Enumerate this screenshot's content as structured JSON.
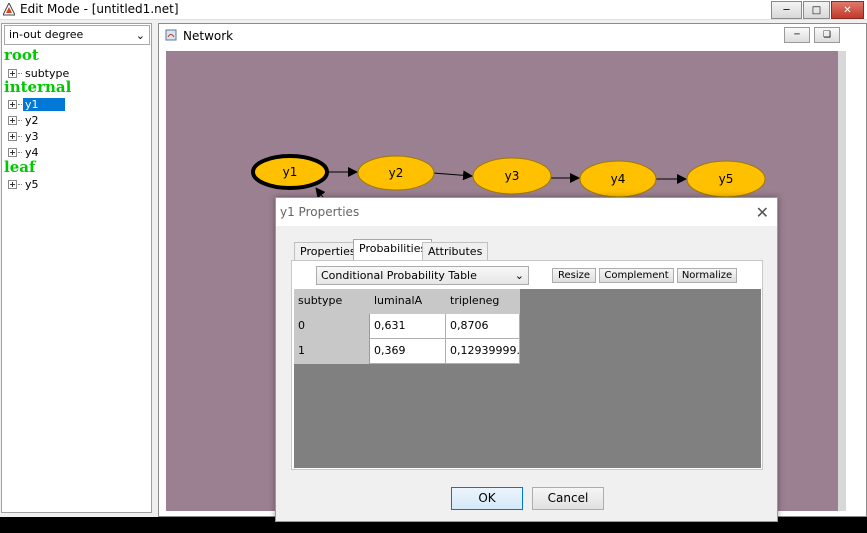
{
  "window": {
    "title": "Edit Mode - [untitled1.net]",
    "controls": [
      "minimize",
      "maximize",
      "close"
    ]
  },
  "left_panel": {
    "view_select": "in-out degree",
    "groups": [
      {
        "header": "root",
        "items": [
          "subtype"
        ]
      },
      {
        "header": "internal",
        "items": [
          "y1",
          "y2",
          "y3",
          "y4"
        ]
      },
      {
        "header": "leaf",
        "items": [
          "y5"
        ]
      }
    ],
    "selected_item": "y1"
  },
  "network": {
    "title": "Network",
    "nodes": [
      "y1",
      "y2",
      "y3",
      "y4",
      "y5"
    ],
    "selected_node": "y1",
    "colors": {
      "canvas": "#9a8090",
      "node_fill": "#ffc000",
      "selected_border": "#000000"
    }
  },
  "dialog": {
    "title": "y1 Properties",
    "tabs": [
      "Properties",
      "Probabilities",
      "Attributes"
    ],
    "active_tab": "Probabilities",
    "table_select": "Conditional Probability Table",
    "buttons": {
      "resize": "Resize",
      "complement": "Complement",
      "normalize": "Normalize"
    },
    "table": {
      "columns": [
        "subtype",
        "luminalA",
        "tripleneg"
      ],
      "rows": [
        {
          "label": "0",
          "values": [
            "0,631",
            "0,8706"
          ]
        },
        {
          "label": "1",
          "values": [
            "0,369",
            "0,12939999..."
          ]
        }
      ]
    },
    "ok": "OK",
    "cancel": "Cancel"
  }
}
